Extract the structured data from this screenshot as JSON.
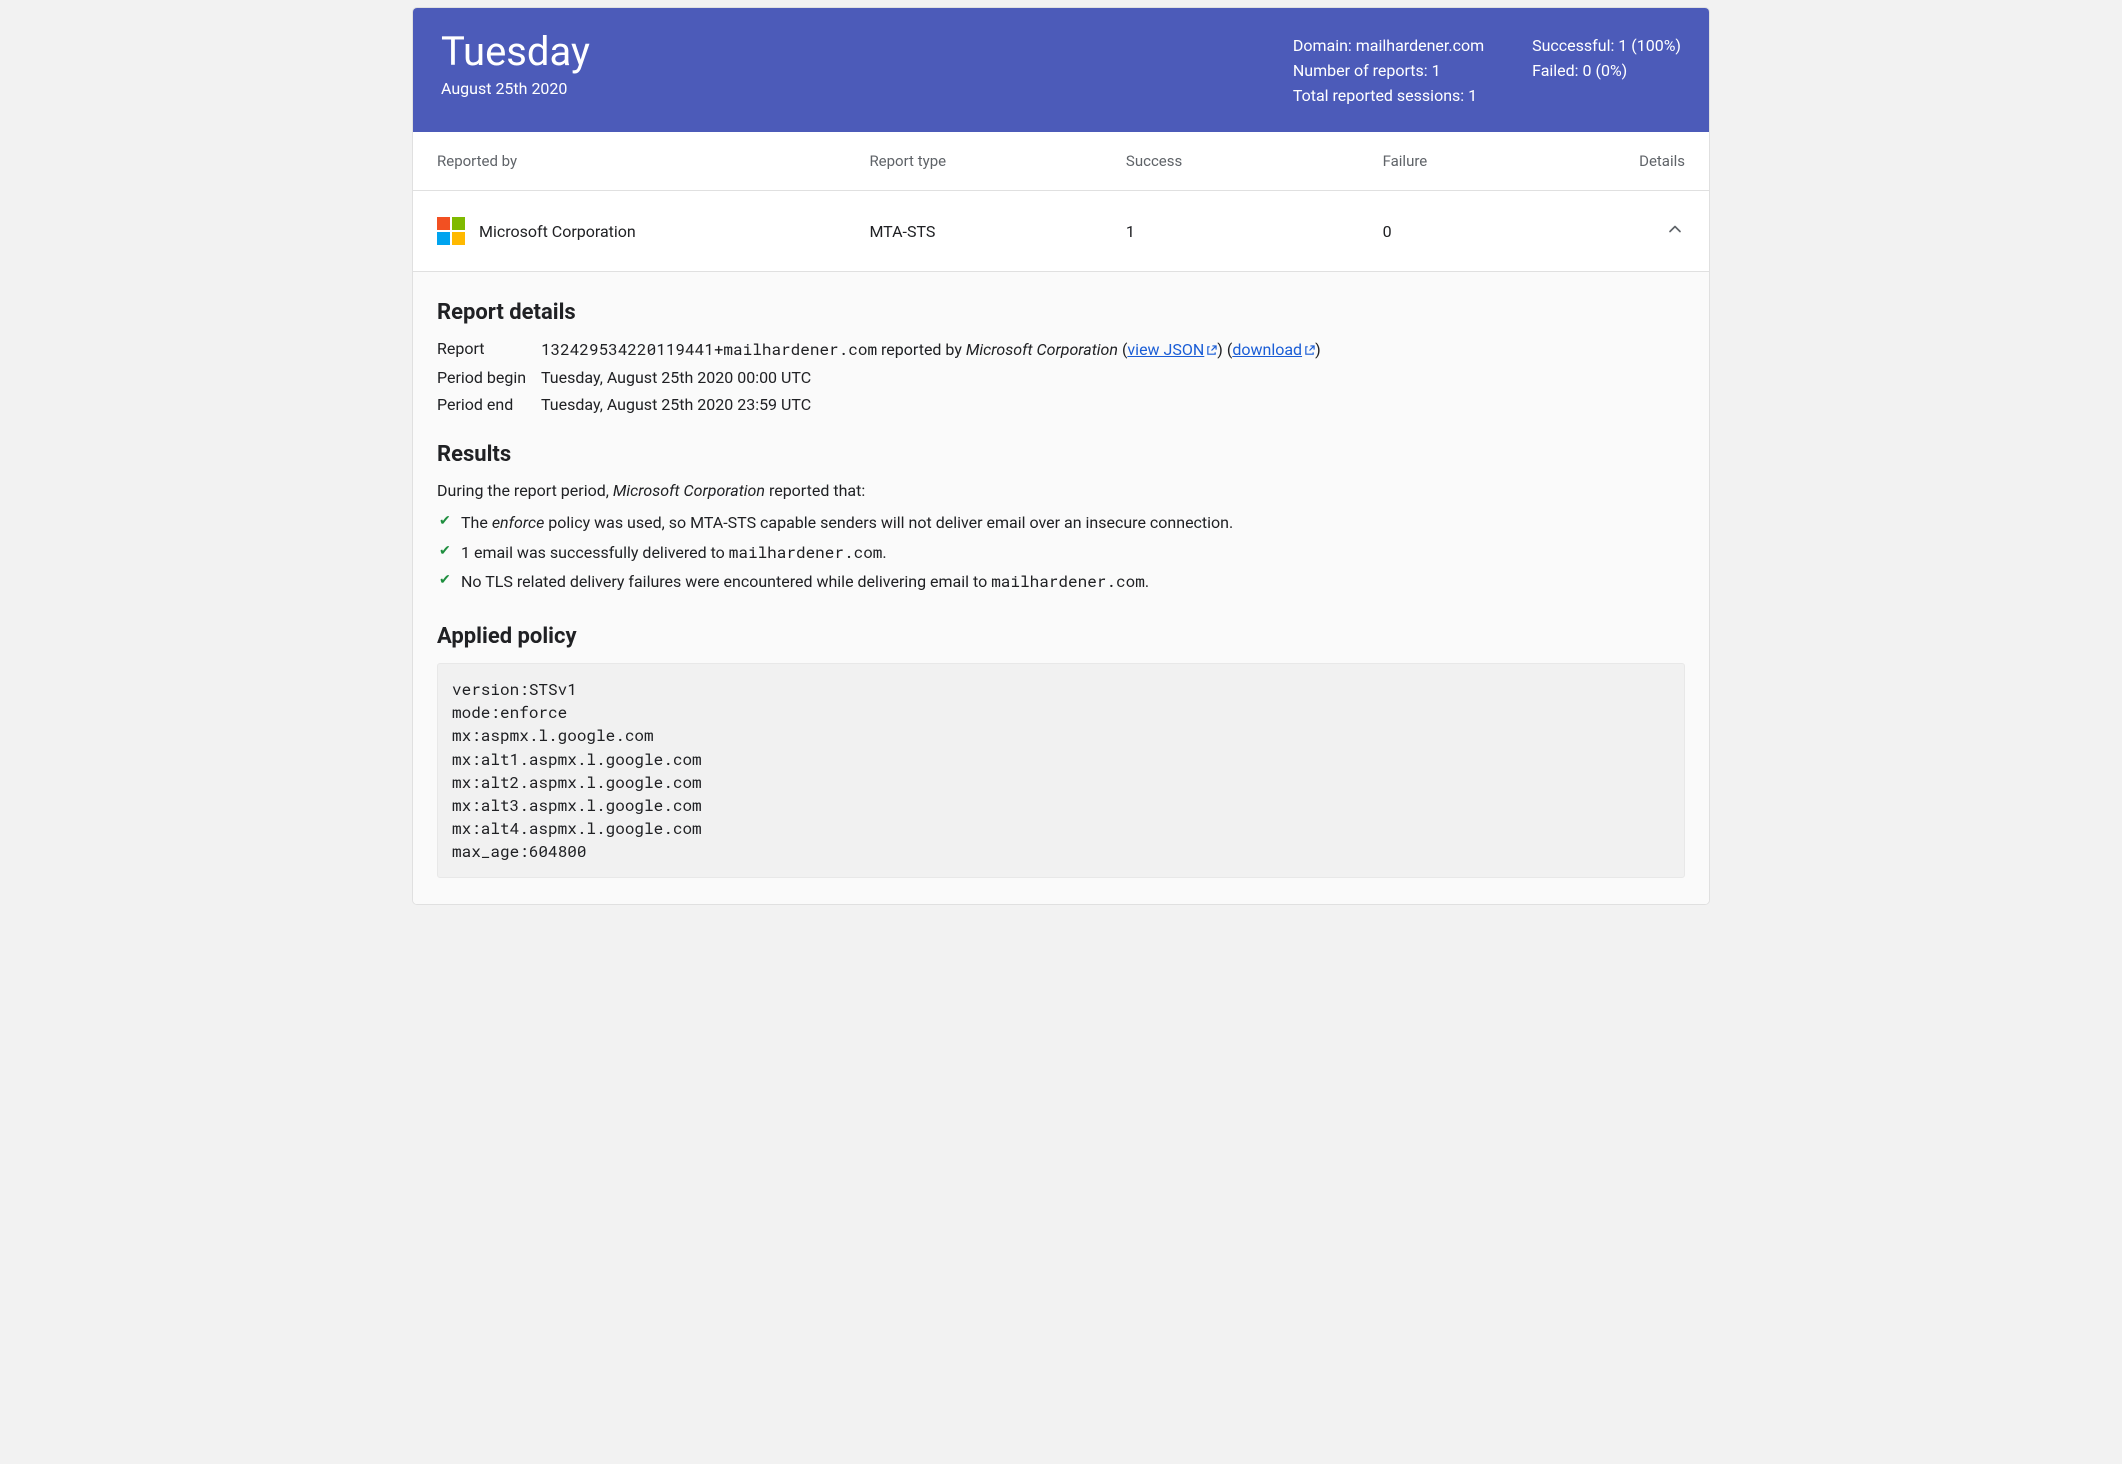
{
  "header": {
    "day": "Tuesday",
    "date": "August 25th 2020",
    "domain_label": "Domain: mailhardener.com",
    "num_reports_label": "Number of reports: 1",
    "total_sessions_label": "Total reported sessions: 1",
    "successful_label": "Successful: 1 (100%)",
    "failed_label": "Failed: 0 (0%)"
  },
  "columns": {
    "reported_by": "Reported by",
    "report_type": "Report type",
    "success": "Success",
    "failure": "Failure",
    "details": "Details"
  },
  "row": {
    "reporter": "Microsoft Corporation",
    "report_type": "MTA-STS",
    "success": "1",
    "failure": "0"
  },
  "details": {
    "heading": "Report details",
    "report_label": "Report",
    "report_id": "132429534220119441+mailhardener.com",
    "reported_by_text": " reported by ",
    "reporter_name": "Microsoft Corporation",
    "view_json_label": "view JSON",
    "download_label": "download",
    "period_begin_label": "Period begin",
    "period_begin_value": "Tuesday, August 25th 2020 00:00 UTC",
    "period_end_label": "Period end",
    "period_end_value": "Tuesday, August 25th 2020 23:59 UTC"
  },
  "results": {
    "heading": "Results",
    "intro_pre": "During the report period, ",
    "intro_reporter": "Microsoft Corporation",
    "intro_post": " reported that:",
    "item1_pre": "The ",
    "item1_policy": "enforce",
    "item1_post": " policy was used, so MTA-STS capable senders will not deliver email over an insecure connection.",
    "item2_pre": "1 email was successfully delivered to ",
    "item2_domain": "mailhardener.com",
    "item2_post": ".",
    "item3_pre": "No TLS related delivery failures were encountered while delivering email to ",
    "item3_domain": "mailhardener.com",
    "item3_post": "."
  },
  "policy": {
    "heading": "Applied policy",
    "text": "version:STSv1\nmode:enforce\nmx:aspmx.l.google.com\nmx:alt1.aspmx.l.google.com\nmx:alt2.aspmx.l.google.com\nmx:alt3.aspmx.l.google.com\nmx:alt4.aspmx.l.google.com\nmax_age:604800"
  }
}
